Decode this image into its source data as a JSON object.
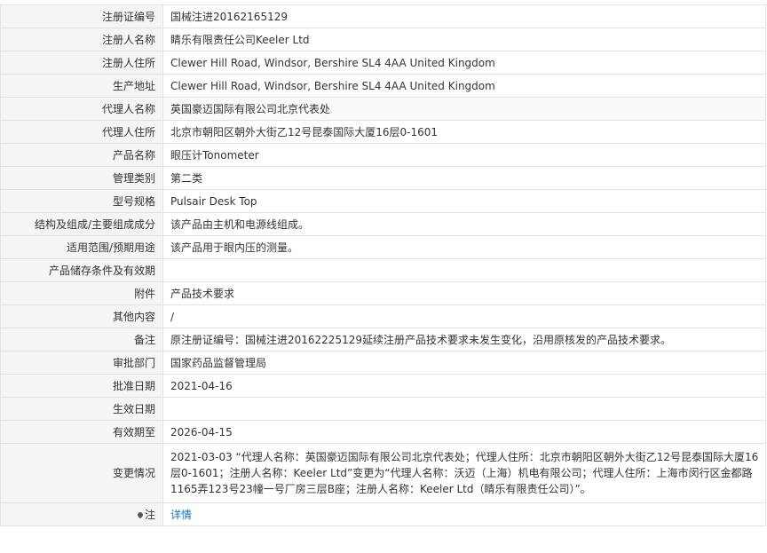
{
  "fields": [
    {
      "label": "注册证编号",
      "value": "国械注进20162165129"
    },
    {
      "label": "注册人名称",
      "value": "睛乐有限责任公司Keeler Ltd"
    },
    {
      "label": "注册人住所",
      "value": "Clewer Hill Road, Windsor, Bershire SL4 4AA United Kingdom"
    },
    {
      "label": "生产地址",
      "value": "Clewer Hill Road, Windsor, Bershire SL4 4AA United Kingdom"
    },
    {
      "label": "代理人名称",
      "value": "英国豪迈国际有限公司北京代表处"
    },
    {
      "label": "代理人住所",
      "value": "北京市朝阳区朝外大街乙12号昆泰国际大厦16层0-1601"
    },
    {
      "label": "产品名称",
      "value": "眼压计Tonometer"
    },
    {
      "label": "管理类别",
      "value": "第二类"
    },
    {
      "label": "型号规格",
      "value": "Pulsair Desk Top"
    },
    {
      "label": "结构及组成/主要组成成分",
      "value": "该产品由主机和电源线组成。"
    },
    {
      "label": "适用范围/预期用途",
      "value": "该产品用于眼内压的测量。"
    },
    {
      "label": "产品储存条件及有效期",
      "value": ""
    },
    {
      "label": "附件",
      "value": "产品技术要求"
    },
    {
      "label": "其他内容",
      "value": "/"
    },
    {
      "label": "备注",
      "value": "原注册证编号：国械注进20162225129延续注册产品技术要求未发生变化，沿用原核发的产品技术要求。"
    },
    {
      "label": "审批部门",
      "value": "国家药品监督管理局"
    },
    {
      "label": "批准日期",
      "value": "2021-04-16"
    },
    {
      "label": "生效日期",
      "value": ""
    },
    {
      "label": "有效期至",
      "value": "2026-04-15"
    },
    {
      "label": "变更情况",
      "value": "2021-03-03 “代理人名称：英国豪迈国际有限公司北京代表处；代理人住所：北京市朝阳区朝外大街乙12号昆泰国际大厦16层0-1601；注册人名称：Keeler Ltd”变更为“代理人名称：沃迈（上海）机电有限公司；代理人住所：上海市闵行区金都路1165弄123号23幢一号厂房三层B座；注册人名称：Keeler Ltd（睛乐有限责任公司）”。"
    }
  ],
  "note": {
    "label": "注",
    "link": "详情",
    "icon": "pin-icon"
  }
}
